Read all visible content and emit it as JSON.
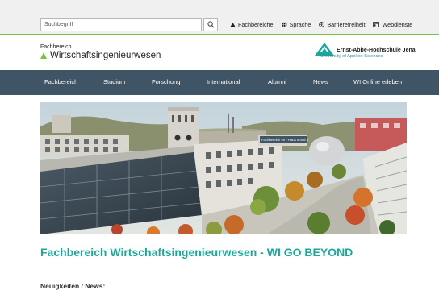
{
  "topbar": {
    "search_placeholder": "Suchbegriff",
    "links": [
      {
        "label": "Fachbereiche",
        "icon": "triangle-icon"
      },
      {
        "label": "Sprache",
        "icon": "globe-icon"
      },
      {
        "label": "Barrierefreiheit",
        "icon": "accessibility-icon"
      },
      {
        "label": "Webdienste",
        "icon": "webservices-icon"
      }
    ]
  },
  "header": {
    "fb_small": "Fachbereich",
    "fb_name": "Wirtschaftsingenieurwesen",
    "uni_name": "Ernst-Abbe-Hochschule Jena",
    "uni_sub": "University of Applied Sciences"
  },
  "nav": {
    "items": [
      "Fachbereich",
      "Studium",
      "Forschung",
      "International",
      "Alumni",
      "News",
      "WI Online erleben"
    ]
  },
  "hero": {
    "building_sign": "Fachbereich WI - Haus 5 und 4"
  },
  "main": {
    "title": "Fachbereich Wirtschaftsingenieurwesen - WI GO BEYOND",
    "news_heading": "Neuigkeiten / News:"
  },
  "colors": {
    "accent_green": "#7cc242",
    "nav_bg": "#3f5565",
    "title_teal": "#1aa89a"
  }
}
